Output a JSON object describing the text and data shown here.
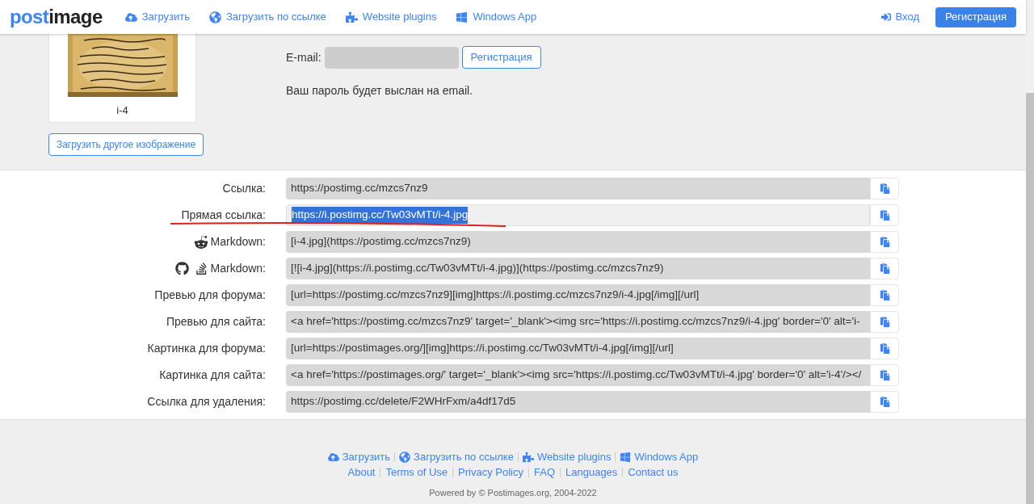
{
  "header": {
    "logo": {
      "primary": "post",
      "secondary": "image"
    },
    "nav": [
      {
        "kind": "upload",
        "label": "Загрузить"
      },
      {
        "kind": "globe",
        "label": "Загрузить по ссылке"
      },
      {
        "kind": "plugin",
        "label": "Website plugins"
      },
      {
        "kind": "windows",
        "label": "Windows App"
      }
    ],
    "login": "Вход",
    "register": "Регистрация"
  },
  "upload": {
    "image": {
      "caption": "i-4"
    },
    "another_button": "Загрузить другое изображение",
    "email_label": "E-mail:",
    "register_button": "Регистрация",
    "note": "Ваш пароль будет выслан на email."
  },
  "links": [
    {
      "kind": "plain",
      "label": "Ссылка:",
      "value": "https://postimg.cc/mzcs7nz9",
      "selected": false
    },
    {
      "kind": "plain",
      "label": "Прямая ссылка:",
      "value": "https://i.postimg.cc/Tw03vMTt/i-4.jpg",
      "selected": true
    },
    {
      "kind": "reddit",
      "label": "Markdown:",
      "value": "[i-4.jpg](https://postimg.cc/mzcs7nz9)",
      "selected": false
    },
    {
      "kind": "github",
      "label": "Markdown:",
      "value": "[![i-4.jpg](https://i.postimg.cc/Tw03vMTt/i-4.jpg)](https://postimg.cc/mzcs7nz9)",
      "selected": false
    },
    {
      "kind": "plain",
      "label": "Превью для форума:",
      "value": "[url=https://postimg.cc/mzcs7nz9][img]https://i.postimg.cc/mzcs7nz9/i-4.jpg[/img][/url]",
      "selected": false
    },
    {
      "kind": "plain",
      "label": "Превью для сайта:",
      "value": "<a href='https://postimg.cc/mzcs7nz9' target='_blank'><img src='https://i.postimg.cc/mzcs7nz9/i-4.jpg' border='0' alt='i-",
      "selected": false
    },
    {
      "kind": "plain",
      "label": "Картинка для форума:",
      "value": "[url=https://postimages.org/][img]https://i.postimg.cc/Tw03vMTt/i-4.jpg[/img][/url]",
      "selected": false
    },
    {
      "kind": "plain",
      "label": "Картинка для сайта:",
      "value": "<a href='https://postimages.org/' target='_blank'><img src='https://i.postimg.cc/Tw03vMTt/i-4.jpg' border='0' alt='i-4'/></",
      "selected": false
    },
    {
      "kind": "plain",
      "label": "Ссылка для удаления:",
      "value": "https://postimg.cc/delete/F2WHrFxm/a4df17d5",
      "selected": false
    }
  ],
  "footer": {
    "nav": [
      {
        "kind": "upload",
        "label": "Загрузить"
      },
      {
        "kind": "globe",
        "label": "Загрузить по ссылке"
      },
      {
        "kind": "plugin",
        "label": "Website plugins"
      },
      {
        "kind": "windows",
        "label": "Windows App"
      }
    ],
    "links": [
      "About",
      "Terms of Use",
      "Privacy Policy",
      "FAQ",
      "Languages",
      "Contact us"
    ],
    "copyright": "Powered by © Postimages.org, 2004-2022"
  }
}
